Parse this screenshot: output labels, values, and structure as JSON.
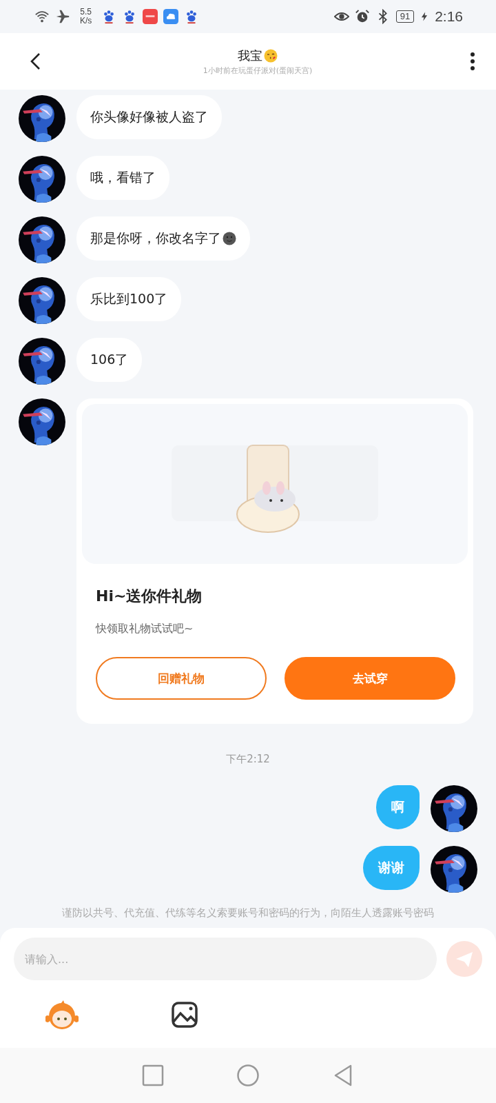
{
  "status_bar": {
    "speed_value": "5.5",
    "speed_unit": "K/s",
    "battery": "91",
    "time": "2:16"
  },
  "header": {
    "title": "我宝",
    "title_icon": {
      "kind": "kiss"
    },
    "subtitle": "1小时前在玩蛋仔派对(蛋闹天宫)"
  },
  "messages": [
    {
      "kind": "incoming",
      "text": "你头像好像被人盗了"
    },
    {
      "kind": "incoming",
      "text": "哦，看错了"
    },
    {
      "kind": "incoming",
      "text": "那是你呀，你改名字了",
      "trailing_icon": {
        "kind": "moon"
      }
    },
    {
      "kind": "incoming",
      "text": "乐比到100了"
    },
    {
      "kind": "incoming",
      "text": "106了"
    },
    {
      "kind": "gift",
      "title": "Hi~送你件礼物",
      "subtitle": "快领取礼物试试吧~",
      "buttons": [
        {
          "label": "回赠礼物",
          "primary": false
        },
        {
          "label": "去试穿",
          "primary": true
        }
      ]
    },
    {
      "kind": "time",
      "text": "下午2:12"
    },
    {
      "kind": "outgoing",
      "text": "啊"
    },
    {
      "kind": "outgoing",
      "text": "谢谢"
    }
  ],
  "notice": "谨防以共号、代充值、代练等名义索要账号和密码的行为，向陌生人透露账号密码",
  "input": {
    "placeholder": "请输入..."
  }
}
